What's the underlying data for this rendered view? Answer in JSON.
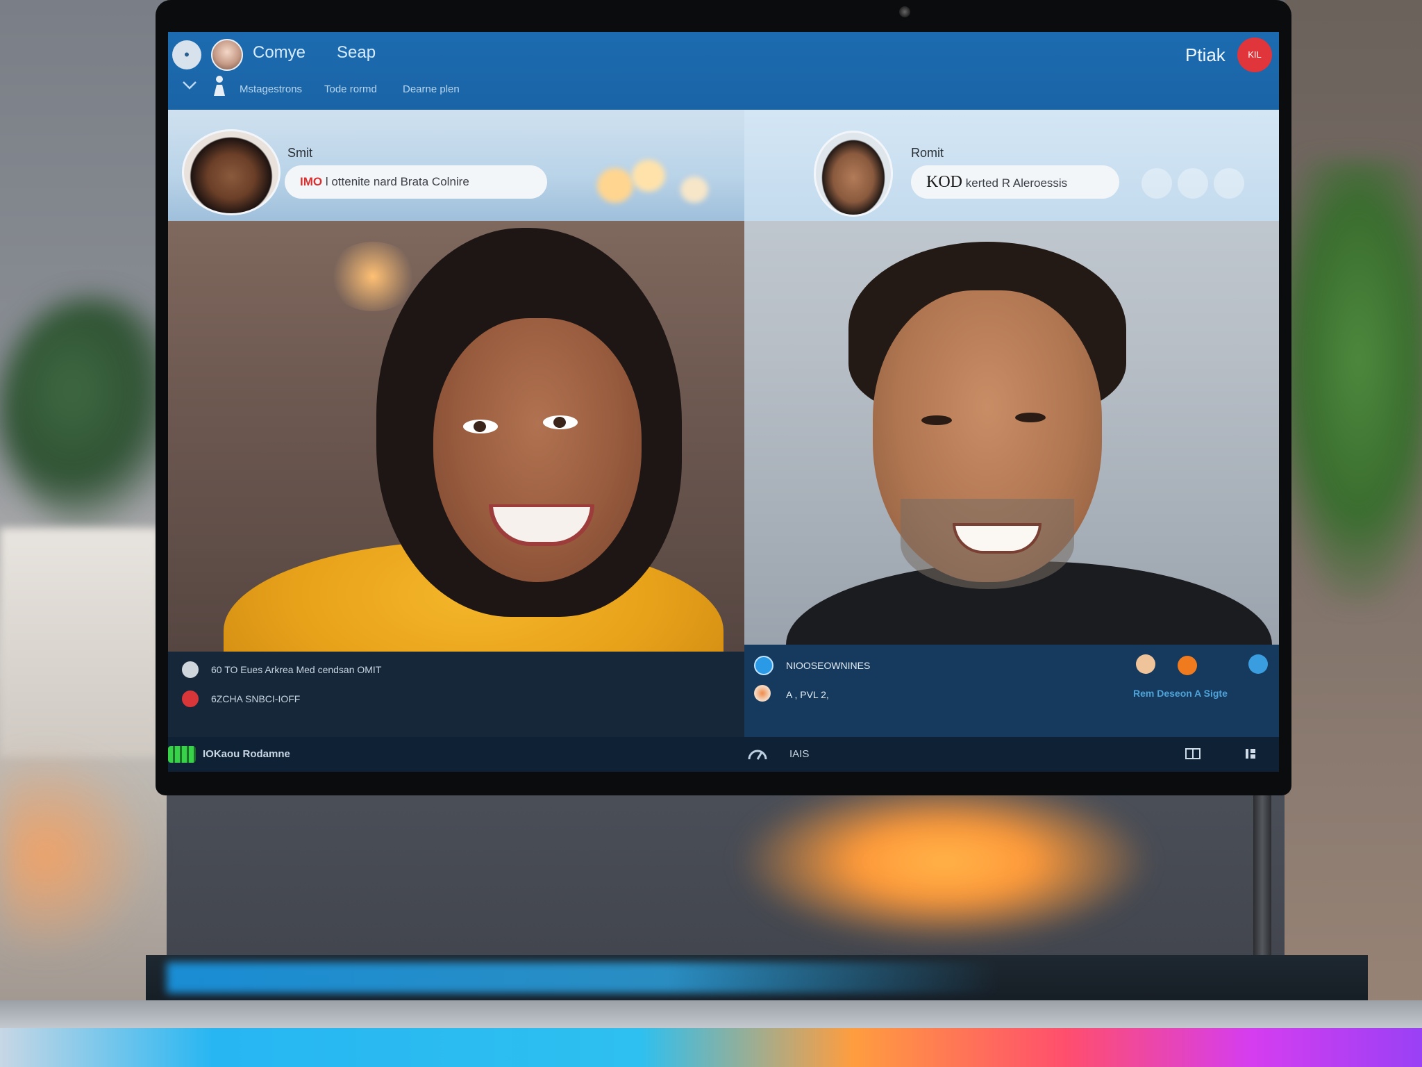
{
  "header": {
    "app_name": "Comye",
    "tab": "Seap",
    "subnav": [
      "Mstagestrons",
      "Tode rormd",
      "Dearne plen"
    ],
    "user_name": "Ptiak",
    "badge": "KIL"
  },
  "tiles": [
    {
      "caller_name": "Smit",
      "status_code": "IMO",
      "status_text": "l ottenite nard Brata Colnire"
    },
    {
      "caller_name": "Romit",
      "status_code": "KOD",
      "status_text": "kerted R Aleroessis"
    }
  ],
  "panel_a": {
    "rows": [
      "60 TO Eues Arkrea Med cendsan OMIT",
      "6ZCHA SNBCI-IOFF"
    ]
  },
  "panel_b": {
    "rows": [
      "NIOOSEOWNINES",
      "A , PVL 2,"
    ],
    "action": "Rem Deseon A Sigte"
  },
  "bottom_bar": {
    "left_label": "IOKaou Rodamne",
    "mid_label": "IAIS"
  },
  "colors": {
    "header": "#1c6bb0",
    "panel": "#16273a",
    "danger": "#e0353a",
    "signal": "#38d24a"
  }
}
